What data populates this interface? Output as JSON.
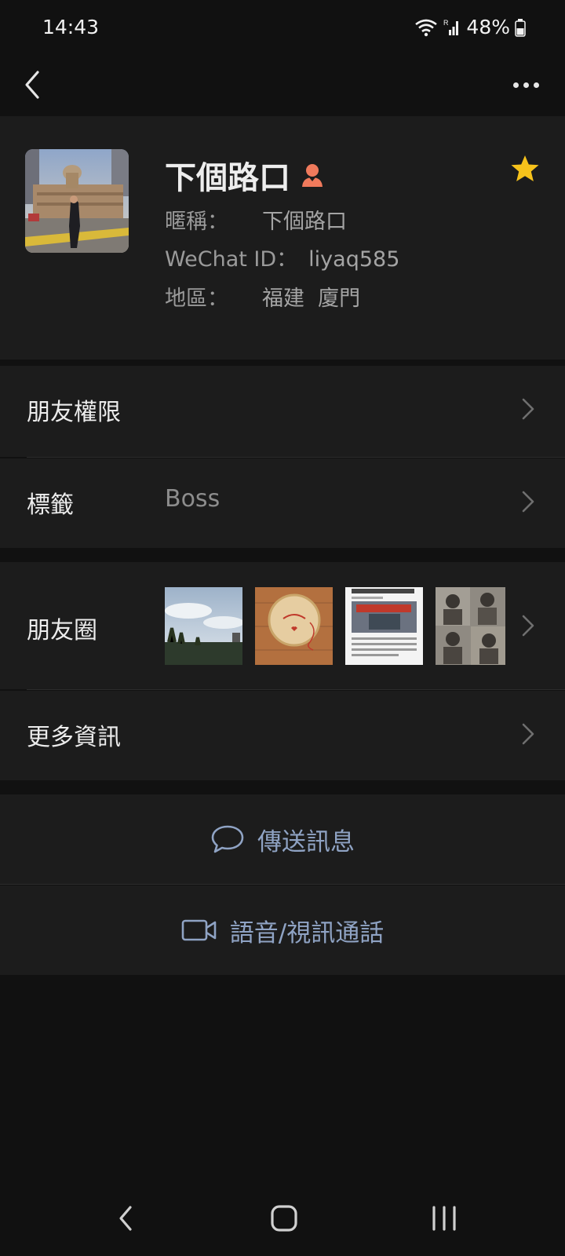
{
  "status_bar": {
    "time": "14:43",
    "battery": "48%"
  },
  "profile": {
    "name": "下個路口",
    "nickname_label": "暱稱：",
    "nickname": "下個路口",
    "wechat_id_label": "WeChat ID：",
    "wechat_id": "liyaq585",
    "region_label": "地區：",
    "region": "福建  廈門"
  },
  "rows": {
    "permission": "朋友權限",
    "tags_label": "標籤",
    "tags_value": "Boss",
    "moments": "朋友圈",
    "more_info": "更多資訊"
  },
  "actions": {
    "send_message": "傳送訊息",
    "call": "語音/視訊通話"
  },
  "colors": {
    "background": "#111111",
    "panel": "#1c1c1c",
    "accent_link": "#8fa3c4",
    "star": "#f6c21b",
    "gender_icon": "#f07a5c"
  },
  "icons": [
    "back-arrow-icon",
    "more-icon",
    "star-icon",
    "female-user-icon",
    "chevron-right-icon",
    "chat-bubble-icon",
    "video-camera-icon"
  ]
}
